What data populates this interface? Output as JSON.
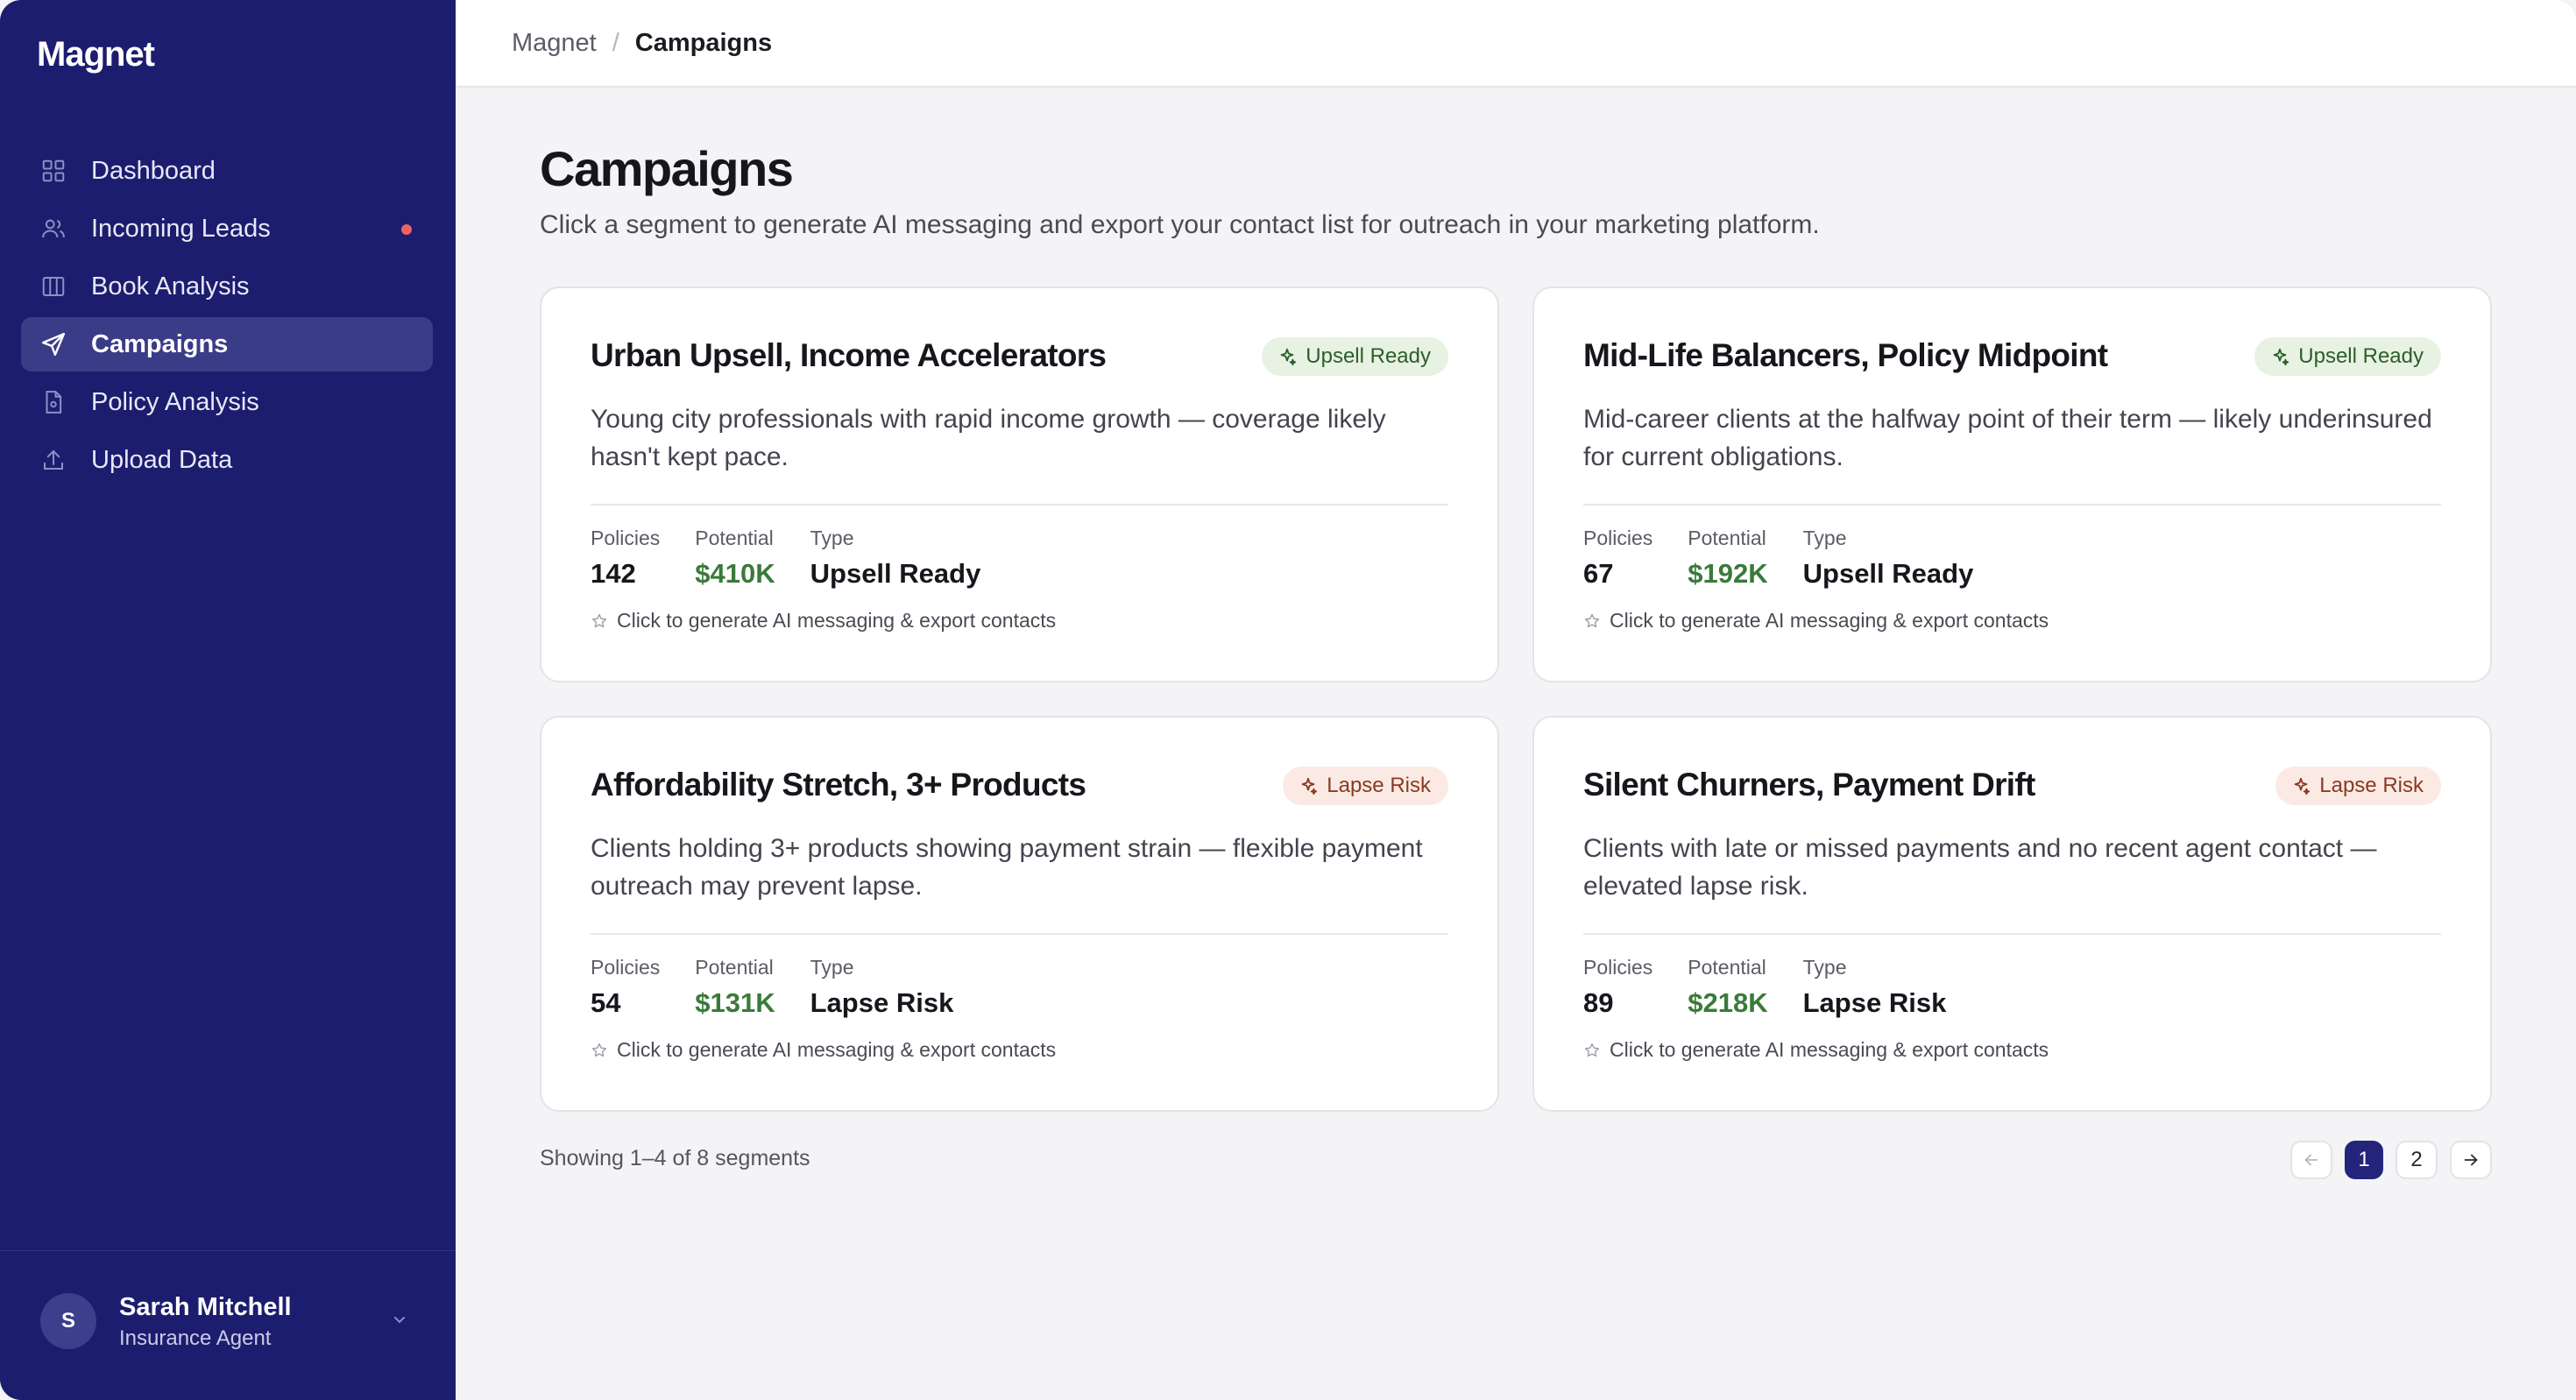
{
  "app": {
    "brand": "Magnet"
  },
  "sidebar": {
    "items": [
      {
        "label": "Dashboard",
        "icon": "grid-icon",
        "active": false
      },
      {
        "label": "Incoming Leads",
        "icon": "users-icon",
        "active": false,
        "notification": true
      },
      {
        "label": "Book Analysis",
        "icon": "columns-icon",
        "active": false
      },
      {
        "label": "Campaigns",
        "icon": "send-icon",
        "active": true
      },
      {
        "label": "Policy Analysis",
        "icon": "file-icon",
        "active": false
      },
      {
        "label": "Upload Data",
        "icon": "upload-icon",
        "active": false
      }
    ],
    "user": {
      "initial": "S",
      "name": "Sarah Mitchell",
      "role": "Insurance Agent"
    }
  },
  "breadcrumb": {
    "root": "Magnet",
    "separator": "/",
    "current": "Campaigns"
  },
  "page": {
    "title": "Campaigns",
    "subtitle": "Click a segment to generate AI messaging and export your contact list for outreach in your marketing platform."
  },
  "cards": [
    {
      "title": "Urban Upsell, Income Accelerators",
      "badge": "Upsell Ready",
      "badge_type": "upsell",
      "description": "Young city professionals with rapid income growth — coverage likely hasn't kept pace.",
      "policies_label": "Policies",
      "policies": "142",
      "potential_label": "Potential",
      "potential": "$410K",
      "type_label": "Type",
      "type": "Upsell Ready",
      "hint": "Click to generate AI messaging & export contacts"
    },
    {
      "title": "Mid-Life Balancers, Policy Midpoint",
      "badge": "Upsell Ready",
      "badge_type": "upsell",
      "description": "Mid-career clients at the halfway point of their term — likely underinsured for current obligations.",
      "policies_label": "Policies",
      "policies": "67",
      "potential_label": "Potential",
      "potential": "$192K",
      "type_label": "Type",
      "type": "Upsell Ready",
      "hint": "Click to generate AI messaging & export contacts"
    },
    {
      "title": "Affordability Stretch, 3+ Products",
      "badge": "Lapse Risk",
      "badge_type": "lapse",
      "description": "Clients holding 3+ products showing payment strain — flexible payment outreach may prevent lapse.",
      "policies_label": "Policies",
      "policies": "54",
      "potential_label": "Potential",
      "potential": "$131K",
      "type_label": "Type",
      "type": "Lapse Risk",
      "hint": "Click to generate AI messaging & export contacts"
    },
    {
      "title": "Silent Churners, Payment Drift",
      "badge": "Lapse Risk",
      "badge_type": "lapse",
      "description": "Clients with late or missed payments and no recent agent contact — elevated lapse risk.",
      "policies_label": "Policies",
      "policies": "89",
      "potential_label": "Potential",
      "potential": "$218K",
      "type_label": "Type",
      "type": "Lapse Risk",
      "hint": "Click to generate AI messaging & export contacts"
    }
  ],
  "footer": {
    "showing": "Showing 1–4 of 8 segments",
    "pages": [
      "1",
      "2"
    ],
    "current_page": "1"
  },
  "colors": {
    "sidebar_bg": "#1c1d6e",
    "active_nav": "#3a3c87",
    "money_green": "#3a7a3a",
    "notification": "#f06363"
  }
}
